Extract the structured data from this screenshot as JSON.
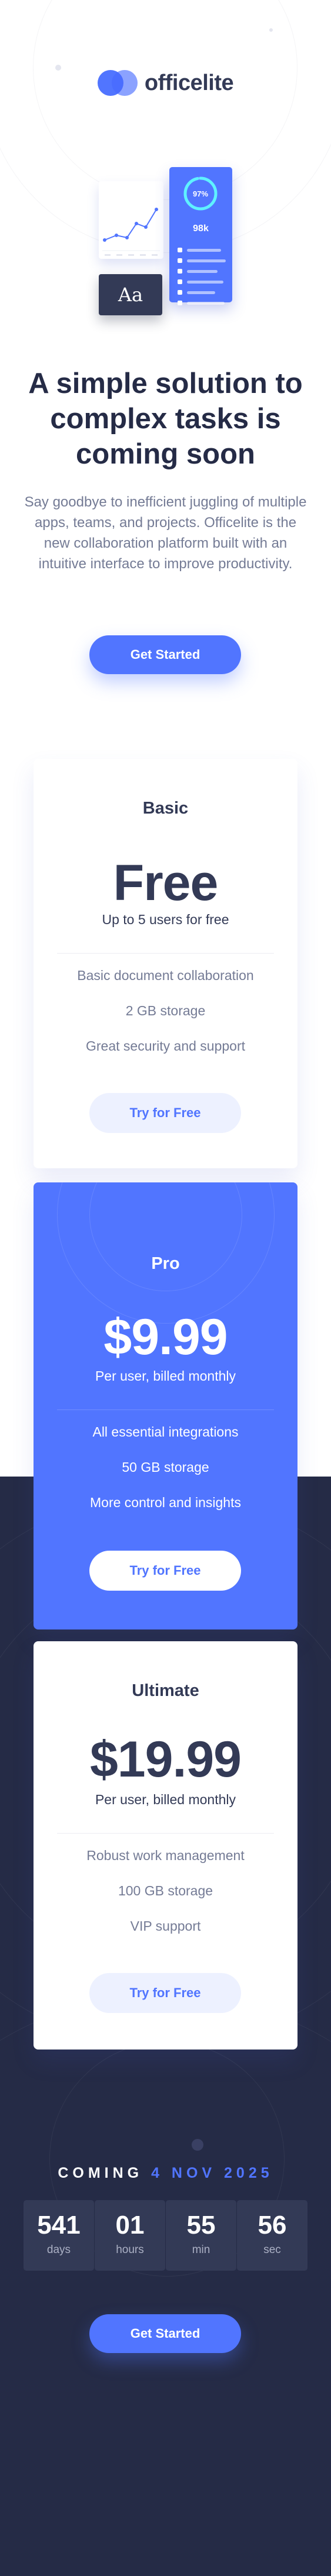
{
  "brand": {
    "name": "officelite"
  },
  "illustration": {
    "progress_label": "97%",
    "stats_value": "98k",
    "font_sample": "Aa"
  },
  "hero": {
    "title": "A simple solution to complex tasks is coming soon",
    "description": "Say goodbye to inefficient juggling of multiple apps, teams, and projects. Officelite is the new collaboration platform built with an intuitive interface to improve productivity.",
    "cta_label": "Get Started"
  },
  "plans": [
    {
      "name": "Basic",
      "price": "Free",
      "subtitle": "Up to 5 users for free",
      "features": [
        "Basic document collaboration",
        "2 GB storage",
        "Great security and support"
      ],
      "cta_label": "Try for Free"
    },
    {
      "name": "Pro",
      "price": "$9.99",
      "subtitle": "Per user, billed monthly",
      "features": [
        "All essential integrations",
        "50 GB storage",
        "More control and insights"
      ],
      "cta_label": "Try for Free"
    },
    {
      "name": "Ultimate",
      "price": "$19.99",
      "subtitle": "Per user, billed monthly",
      "features": [
        "Robust work management",
        "100 GB storage",
        "VIP support"
      ],
      "cta_label": "Try for Free"
    }
  ],
  "countdown": {
    "prefix": "COMING",
    "date": "4 NOV 2025",
    "units": [
      {
        "value": "541",
        "label": "days"
      },
      {
        "value": "01",
        "label": "hours"
      },
      {
        "value": "55",
        "label": "min"
      },
      {
        "value": "56",
        "label": "sec"
      }
    ],
    "cta_label": "Get Started"
  },
  "colors": {
    "accent": "#5175ff",
    "dark": "#252b46",
    "text": "#333a56",
    "muted": "#747b95"
  }
}
